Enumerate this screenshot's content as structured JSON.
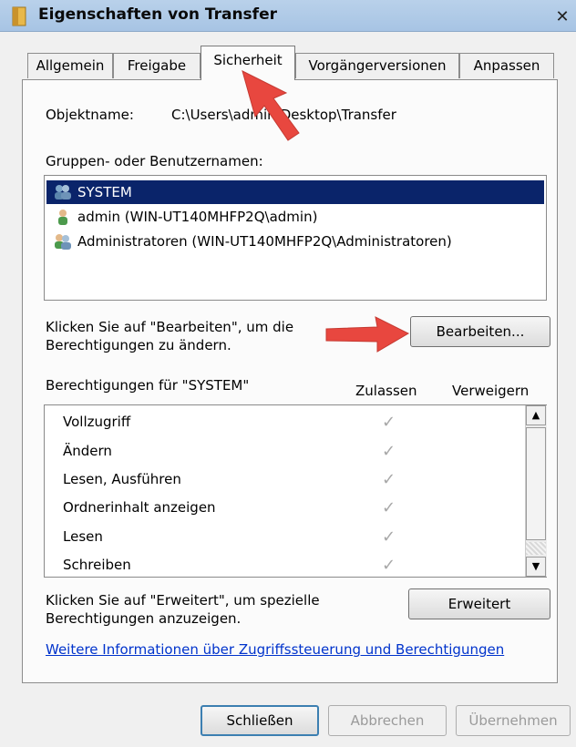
{
  "window": {
    "title": "Eigenschaften von Transfer",
    "close_glyph": "✕"
  },
  "tabs": [
    {
      "label": "Allgemein"
    },
    {
      "label": "Freigabe"
    },
    {
      "label": "Sicherheit"
    },
    {
      "label": "Vorgängerversionen"
    },
    {
      "label": "Anpassen"
    }
  ],
  "object": {
    "label": "Objektname:",
    "value": "C:\\Users\\admin\\Desktop\\Transfer"
  },
  "groups": {
    "label": "Gruppen- oder Benutzernamen:",
    "items": [
      {
        "name": "SYSTEM",
        "icon": "users-group-icon"
      },
      {
        "name": "admin (WIN-UT140MHFP2Q\\admin)",
        "icon": "user-icon"
      },
      {
        "name": "Administratoren (WIN-UT140MHFP2Q\\Administratoren)",
        "icon": "admin-group-icon"
      }
    ]
  },
  "edit": {
    "hint_line1": "Klicken Sie auf \"Bearbeiten\", um die",
    "hint_line2": "Berechtigungen zu ändern.",
    "button": "Bearbeiten..."
  },
  "permissions": {
    "title": "Berechtigungen für \"SYSTEM\"",
    "col_allow": "Zulassen",
    "col_deny": "Verweigern",
    "check_glyph": "✓",
    "rows": [
      {
        "name": "Vollzugriff"
      },
      {
        "name": "Ändern"
      },
      {
        "name": "Lesen, Ausführen"
      },
      {
        "name": "Ordnerinhalt anzeigen"
      },
      {
        "name": "Lesen"
      },
      {
        "name": "Schreiben"
      }
    ]
  },
  "advanced": {
    "hint_line1": "Klicken Sie auf \"Erweitert\", um spezielle",
    "hint_line2": "Berechtigungen anzuzeigen.",
    "button": "Erweitert"
  },
  "help_link": "Weitere Informationen über Zugriffssteuerung und Berechtigungen",
  "footer": {
    "close": "Schließen",
    "cancel": "Abbrechen",
    "apply": "Übernehmen"
  },
  "colors": {
    "selection": "#0a246a",
    "link": "#0033cc",
    "annotation_arrow": "#e8473f"
  }
}
